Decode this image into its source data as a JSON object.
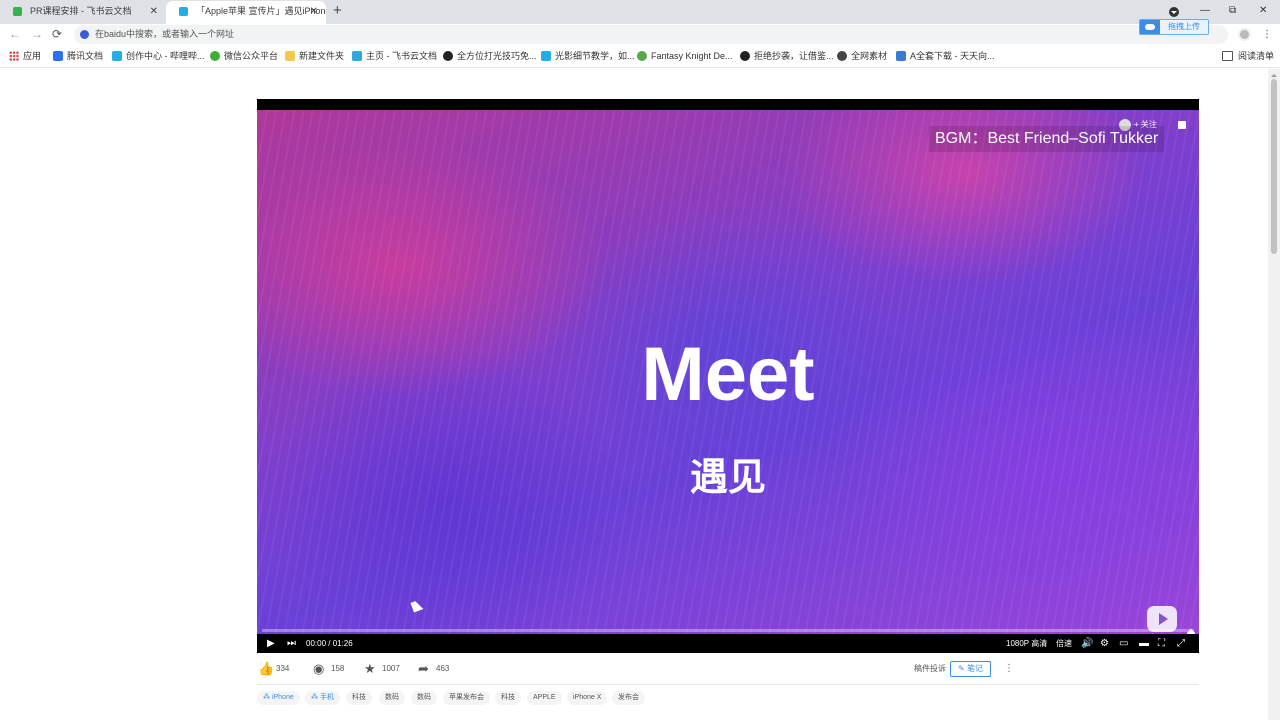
{
  "tabs": [
    {
      "title": "PR课程安排 - 飞书云文档",
      "active": false,
      "favicon_color": "#34b34a"
    },
    {
      "title": "「Apple苹果 宣传片」遇见iPhone",
      "active": true,
      "favicon_color": "#23ade5"
    }
  ],
  "window_controls": {
    "minimize": "—",
    "maximize": "⧉",
    "close": "✕"
  },
  "toolbar": {
    "back": "←",
    "forward": "→",
    "reload": "⟳",
    "omnibox_placeholder": "在baidu中搜索，或者输入一个网址",
    "cloud_upload_label": "拖拽上传"
  },
  "bookmarks": [
    {
      "label": "应用"
    },
    {
      "label": "腾讯文档",
      "color": "#2f6ef6"
    },
    {
      "label": "创作中心 - 哔哩哔...",
      "color": "#23ade5"
    },
    {
      "label": "微信公众平台",
      "color": "#3cb034"
    },
    {
      "label": "新建文件夹",
      "color": "#f2c94c"
    },
    {
      "label": "主页 - 飞书云文档",
      "color": "#2fa8e0"
    },
    {
      "label": "全方位打光技巧免...",
      "color": "#222222"
    },
    {
      "label": "光影细节教学，如...",
      "color": "#23ade5"
    },
    {
      "label": "Fantasy Knight De...",
      "color": "#56a845"
    },
    {
      "label": "拒绝抄袭，让借鉴...",
      "color": "#222222"
    },
    {
      "label": "全网素材",
      "color": "#444444"
    },
    {
      "label": "A全套下载 - 天天向...",
      "color": "#3a7bd5"
    }
  ],
  "reading_list": "阅读清单",
  "video": {
    "bgm": "BGM：Best Friend–Sofi Tukker",
    "follow": "+ 关注",
    "title_en": "Meet",
    "title_cn": "遇见",
    "time": "00:00 / 01:26",
    "quality": "1080P 高清",
    "speed": "倍速",
    "progress": 0
  },
  "stats": [
    {
      "icon": "thumbs-up-icon",
      "glyph": "👍",
      "value": "334"
    },
    {
      "icon": "coin-icon",
      "glyph": "◉",
      "value": "158"
    },
    {
      "icon": "star-icon",
      "glyph": "★",
      "value": "1007"
    },
    {
      "icon": "share-icon",
      "glyph": "➦",
      "value": "463"
    }
  ],
  "actions": {
    "report": "稿件投诉",
    "note": "笔记",
    "more": "⋮"
  },
  "tags": [
    {
      "label": "iPhone",
      "highlight": true
    },
    {
      "label": "手机",
      "highlight": true
    },
    {
      "label": "科技"
    },
    {
      "label": "数码"
    },
    {
      "label": "数码"
    },
    {
      "label": "苹果发布会"
    },
    {
      "label": "科技"
    },
    {
      "label": "APPLE"
    },
    {
      "label": "iPhone X"
    },
    {
      "label": "发布会"
    }
  ]
}
